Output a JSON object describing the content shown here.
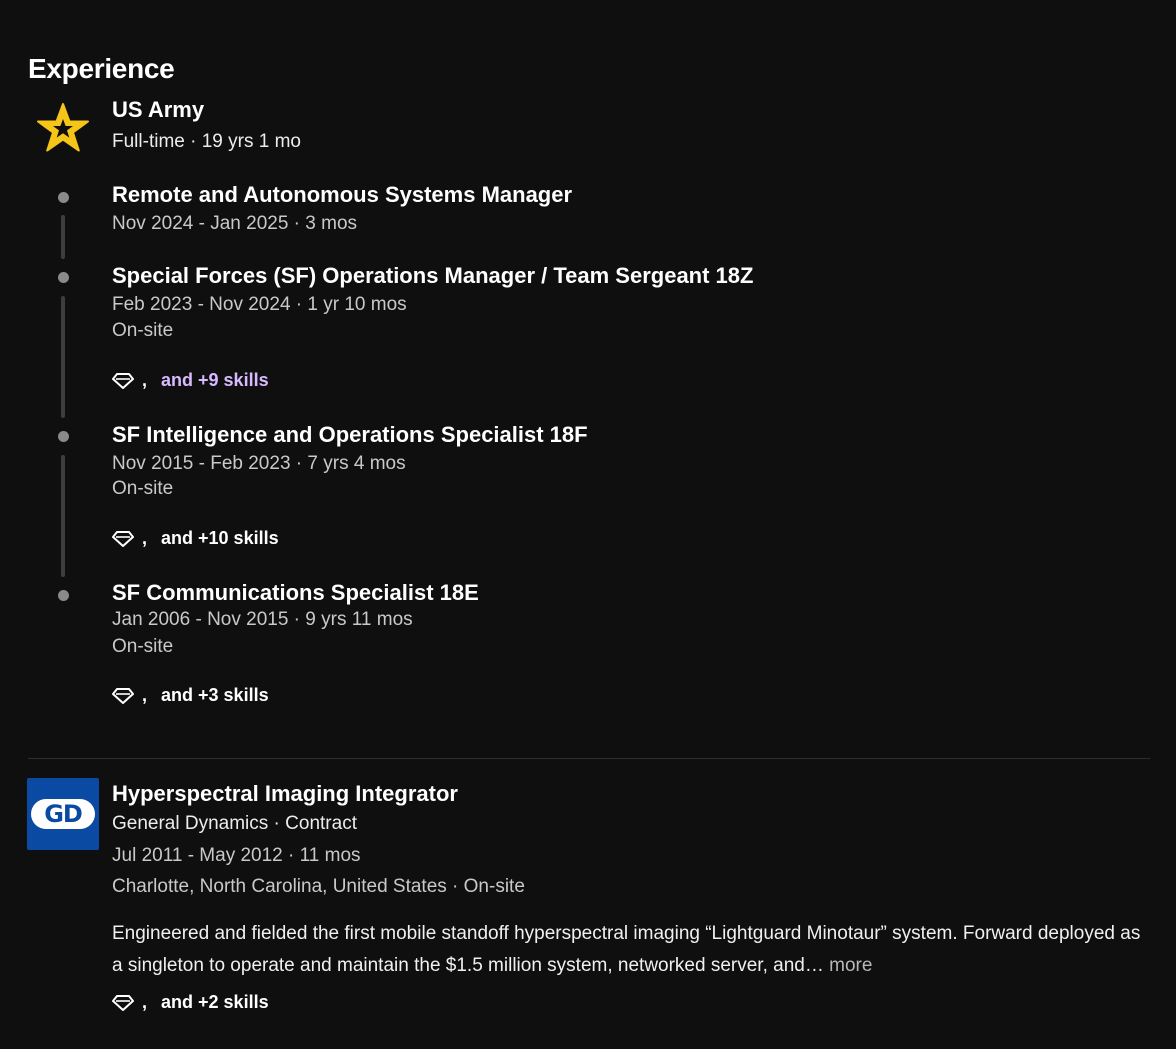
{
  "section": {
    "title": "Experience"
  },
  "army": {
    "name": "US Army",
    "subtitle": "Full-time · 19 yrs 1 mo",
    "logo_color": "#f5c518",
    "roles": [
      {
        "title": "Remote and Autonomous Systems Manager",
        "dates": "Nov 2024 - Jan 2025 · 3 mos"
      },
      {
        "title": "Special Forces (SF) Operations Manager / Team Sergeant 18Z",
        "dates": "Feb 2023 - Nov 2024 · 1 yr 10 mos",
        "location": "On-site",
        "skills_comma": ",",
        "skills_text": "and +9 skills"
      },
      {
        "title": "SF Intelligence and Operations Specialist 18F",
        "dates": "Nov 2015 - Feb 2023 · 7 yrs 4 mos",
        "location": "On-site",
        "skills_comma": ",",
        "skills_text": "and +10 skills"
      },
      {
        "title": "SF Communications Specialist 18E",
        "dates": "Jan 2006 - Nov 2015 · 9 yrs 11 mos",
        "location": "On-site",
        "skills_comma": ",",
        "skills_text": "and +3 skills"
      }
    ]
  },
  "gd": {
    "logo_text": "GD",
    "logo_color": "#0b4aa3",
    "title": "Hyperspectral Imaging Integrator",
    "company": "General Dynamics · Contract",
    "dates": "Jul 2011 - May 2012 · 11 mos",
    "location": "Charlotte, North Carolina, United States · On-site",
    "description": "Engineered and fielded the first mobile standoff hyperspectral imaging “Lightguard Minotaur” system. Forward deployed as a singleton to operate and maintain the $1.5 million system, networked server, and…",
    "more_label": "more",
    "skills_comma": ",",
    "skills_text": "and +2 skills"
  },
  "colors": {
    "background": "#0f0f10",
    "visited_link": "#d9b9ff",
    "timeline": "#3d3d40"
  }
}
